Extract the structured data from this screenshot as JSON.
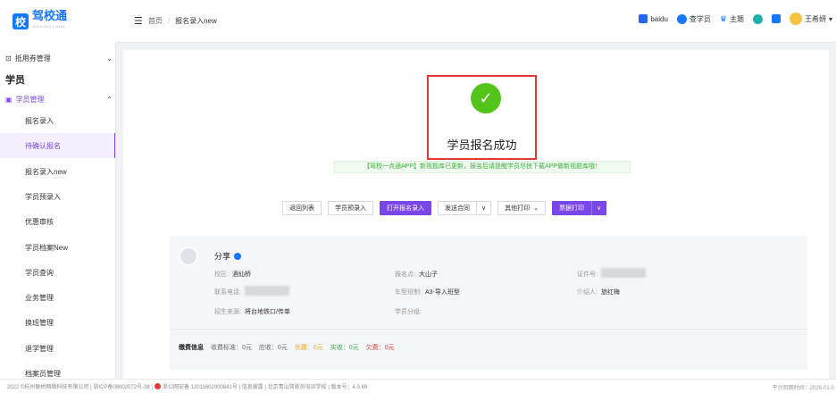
{
  "app": {
    "logo_mark": "校",
    "logo_text": "驾校通",
    "logo_sub": "JIAXIAOTONG"
  },
  "header": {
    "breadcrumb_home": "首页",
    "breadcrumb_sep": "/",
    "breadcrumb_current": "报名录入new",
    "right": {
      "baidu": "baidu",
      "student_search": "查学员",
      "theme": "主题",
      "user_name": "王希妍"
    }
  },
  "sidebar": {
    "group1": "抵用券管理",
    "section": "学员",
    "group2": "学员管理",
    "items": [
      {
        "label": "报名录入"
      },
      {
        "label": "待确认报名"
      },
      {
        "label": "报名录入new"
      },
      {
        "label": "学员预录入"
      },
      {
        "label": "优惠审核"
      },
      {
        "label": "学员档案New"
      },
      {
        "label": "学员查询"
      },
      {
        "label": "业务管理"
      },
      {
        "label": "换班管理"
      },
      {
        "label": "退学管理"
      },
      {
        "label": "档案员管理"
      }
    ]
  },
  "success": {
    "title": "学员报名成功",
    "notice": "【驾校一点通APP】新视题库已更新，报名后请提醒学员尽快下载APP做新视题库哦！"
  },
  "actions": {
    "back_list": "返回列表",
    "pre_entry": "学员预录入",
    "open_entry": "打开报名录入",
    "send_contract": "发送合同",
    "other_print": "其他打印",
    "receipt_print": "票据打印",
    "chevron": "∨"
  },
  "student": {
    "name": "分享",
    "campus_label": "校区:",
    "campus": "酒仙桥",
    "signup_label": "报名点:",
    "signup": "大山子",
    "id_label": "证件号:",
    "phone_label": "联系电话:",
    "class_label": "车型班制:",
    "class": "A3-导入班型",
    "referrer_label": "介绍人:",
    "referrer": "旅红梅",
    "source_label": "招生来源:",
    "source": "将台地铁口/传单",
    "group_label": "学员分组:"
  },
  "fees": {
    "label": "缴费信息",
    "standard": "收费标准：0元",
    "receivable": "应收：0元",
    "discount": "优惠：0元",
    "paid": "实收：0元",
    "owed": "欠费：0元"
  },
  "footer": {
    "left": "2022 ©杭州联桥网络科技有限公司 | 浙ICP备09002072号-38 |",
    "police": "浙公网安备 12011602000841号 | 信息披露 | 北京青山驾驶员培训学校 | 版本号：4.0.69",
    "right": "平台到期时间：2025-01-0"
  }
}
